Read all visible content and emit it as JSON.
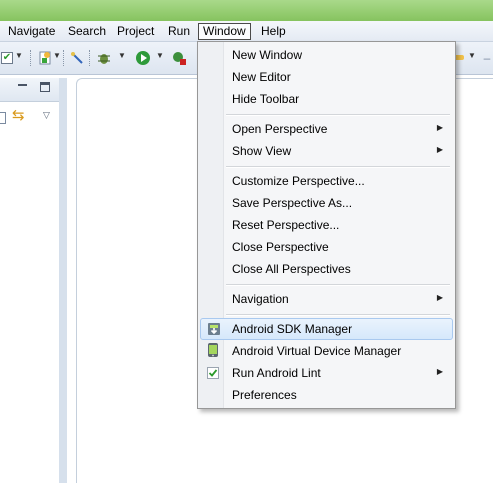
{
  "menubar": {
    "items": [
      {
        "label": "Navigate"
      },
      {
        "label": "Search"
      },
      {
        "label": "Project"
      },
      {
        "label": "Run"
      },
      {
        "label": "Window"
      },
      {
        "label": "Help"
      }
    ],
    "active": "Window"
  },
  "toolbar": {
    "icons": [
      "checkbox-icon",
      "new-class-icon",
      "toggle-icon",
      "debug-icon",
      "run-icon",
      "external-tool-icon",
      "lamp-icon"
    ]
  },
  "left_panel": {
    "icons": [
      "minimize-icon",
      "maximize-icon",
      "collapse-icon",
      "link-editor-icon",
      "view-menu-icon"
    ]
  },
  "window_menu": {
    "items": [
      {
        "label": "New Window",
        "submenu": false
      },
      {
        "label": "New Editor",
        "submenu": false
      },
      {
        "label": "Hide Toolbar",
        "submenu": false
      },
      {
        "label": "Open Perspective",
        "submenu": true
      },
      {
        "label": "Show View",
        "submenu": true
      },
      {
        "label": "Customize Perspective...",
        "submenu": false
      },
      {
        "label": "Save Perspective As...",
        "submenu": false
      },
      {
        "label": "Reset Perspective...",
        "submenu": false
      },
      {
        "label": "Close Perspective",
        "submenu": false
      },
      {
        "label": "Close All Perspectives",
        "submenu": false
      },
      {
        "label": "Navigation",
        "submenu": true
      },
      {
        "label": "Android SDK Manager",
        "submenu": false,
        "icon": "android-sdk-icon",
        "highlighted": true
      },
      {
        "label": "Android Virtual Device Manager",
        "submenu": false,
        "icon": "android-avd-icon"
      },
      {
        "label": "Run Android Lint",
        "submenu": true,
        "icon": "checkmark-icon"
      },
      {
        "label": "Preferences",
        "submenu": false
      }
    ]
  },
  "colors": {
    "titlebar": "#86c35f",
    "highlight": "#d6e8fb",
    "menu_bg": "#f5f6f8"
  }
}
